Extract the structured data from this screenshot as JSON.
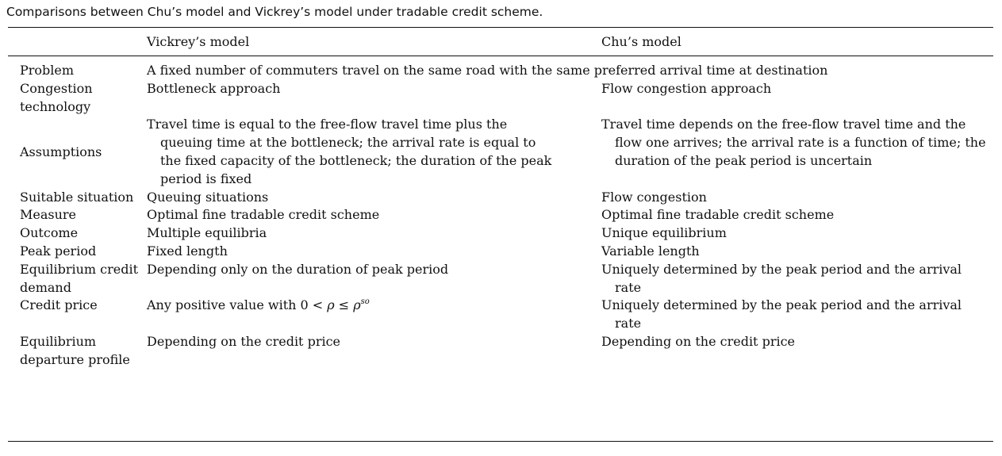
{
  "caption": "Comparisons between Chu’s model and Vickrey’s model under tradable credit scheme.",
  "headers": [
    "",
    "Vickrey’s model",
    "Chu’s model"
  ],
  "problem": {
    "label": "Problem",
    "text": "A fixed number of commuters travel on the same road with the same preferred arrival time at destination"
  },
  "rows": [
    {
      "label": "Congestion technology",
      "vickrey": "Bottleneck approach",
      "chu": "Flow congestion approach"
    },
    {
      "label": "Assumptions",
      "vickrey": "Travel time is equal to the free-flow travel time plus the queuing time at the bottleneck; the arrival rate is equal to the fixed capacity of the bottleneck; the duration of the peak period is fixed",
      "chu": "Travel time depends on the free-flow travel time and the flow one arrives; the arrival rate is a function of time; the duration of the peak period is uncertain"
    },
    {
      "label": "Suitable situation",
      "vickrey": "Queuing situations",
      "chu": "Flow congestion"
    },
    {
      "label": "Measure",
      "vickrey": "Optimal fine tradable credit scheme",
      "chu": "Optimal fine tradable credit scheme"
    },
    {
      "label": "Outcome",
      "vickrey": "Multiple equilibria",
      "chu": "Unique equilibrium"
    },
    {
      "label": "Peak period",
      "vickrey": "Fixed length",
      "chu": "Variable length"
    },
    {
      "label": "Equilibrium credit demand",
      "vickrey": "Depending only on the duration of peak period",
      "chu": "Uniquely determined by the peak period and the arrival rate"
    },
    {
      "label": "Credit price",
      "vickrey_prefix": "Any positive value with 0 < ",
      "vickrey_sym1": "ρ",
      "vickrey_mid": " ≤ ",
      "vickrey_sym2": "ρ",
      "vickrey_sup": "so",
      "chu": "Uniquely determined by the peak period and the arrival rate"
    },
    {
      "label": "Equilibrium departure profile",
      "vickrey": "Depending on the credit price",
      "chu": "Depending on the credit price"
    }
  ]
}
